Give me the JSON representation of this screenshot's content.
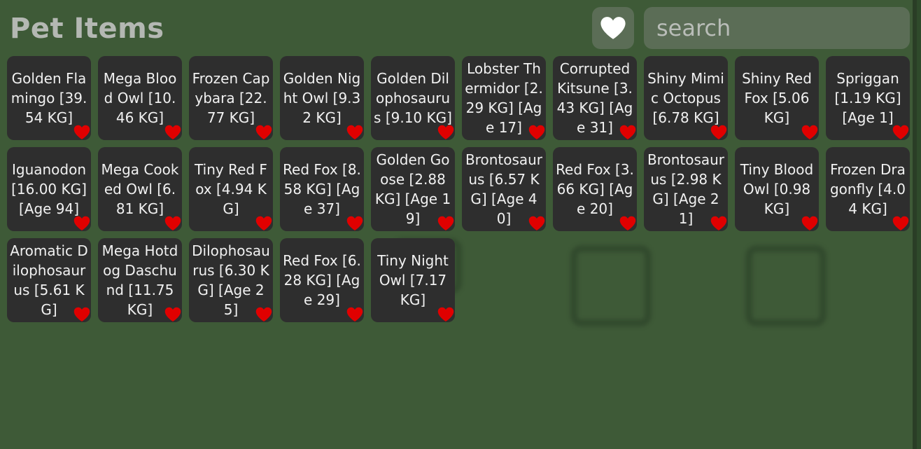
{
  "header": {
    "title": "Pet Items",
    "search_placeholder": "search",
    "favorite_filter_icon": "heart-icon"
  },
  "colors": {
    "card_bg": "#2e2e2e",
    "heart": "#e00000",
    "panel_bg": "#3e5a37"
  },
  "items": [
    {
      "label": "Golden Flamingo [39.54 KG]",
      "favorite_icon": "heart-icon"
    },
    {
      "label": "Mega Blood Owl [10.46 KG]",
      "favorite_icon": "heart-icon"
    },
    {
      "label": "Frozen Capybara [22.77 KG]",
      "favorite_icon": "heart-icon"
    },
    {
      "label": "Golden Night Owl [9.32 KG]",
      "favorite_icon": "heart-icon"
    },
    {
      "label": "Golden Dilophosaurus [9.10 KG]",
      "favorite_icon": "heart-icon"
    },
    {
      "label": "Lobster Thermidor [2.29 KG] [Age 17]",
      "favorite_icon": "heart-icon"
    },
    {
      "label": "Corrupted Kitsune [3.43 KG] [Age 31]",
      "favorite_icon": "heart-icon"
    },
    {
      "label": "Shiny Mimic Octopus [6.78 KG]",
      "favorite_icon": "heart-icon"
    },
    {
      "label": "Shiny Red Fox [5.06 KG]",
      "favorite_icon": "heart-icon"
    },
    {
      "label": "Spriggan [1.19 KG] [Age 1]",
      "favorite_icon": "heart-icon"
    },
    {
      "label": "Iguanodon [16.00 KG] [Age 94]",
      "favorite_icon": "heart-icon"
    },
    {
      "label": "Mega Cooked Owl [6.81 KG]",
      "favorite_icon": "heart-icon"
    },
    {
      "label": "Tiny Red Fox [4.94 KG]",
      "favorite_icon": "heart-icon"
    },
    {
      "label": "Red Fox [8.58 KG] [Age 37]",
      "favorite_icon": "heart-icon"
    },
    {
      "label": "Golden Goose [2.88 KG] [Age 19]",
      "favorite_icon": "heart-icon"
    },
    {
      "label": "Brontosaurus [6.57 KG] [Age 40]",
      "favorite_icon": "heart-icon"
    },
    {
      "label": "Red Fox [3.66 KG] [Age 20]",
      "favorite_icon": "heart-icon"
    },
    {
      "label": "Brontosaurus [2.98 KG] [Age 21]",
      "favorite_icon": "heart-icon"
    },
    {
      "label": "Tiny Blood Owl [0.98 KG]",
      "favorite_icon": "heart-icon"
    },
    {
      "label": "Frozen Dragonfly [4.04 KG]",
      "favorite_icon": "heart-icon"
    },
    {
      "label": "Aromatic Dilophosaurus [5.61 KG]",
      "favorite_icon": "heart-icon"
    },
    {
      "label": "Mega Hotdog Daschund [11.75 KG]",
      "favorite_icon": "heart-icon"
    },
    {
      "label": "Dilophosaurus [6.30 KG] [Age 25]",
      "favorite_icon": "heart-icon"
    },
    {
      "label": "Red Fox [6.28 KG] [Age 29]",
      "favorite_icon": "heart-icon"
    },
    {
      "label": "Tiny Night Owl [7.17 KG]",
      "favorite_icon": "heart-icon"
    }
  ]
}
